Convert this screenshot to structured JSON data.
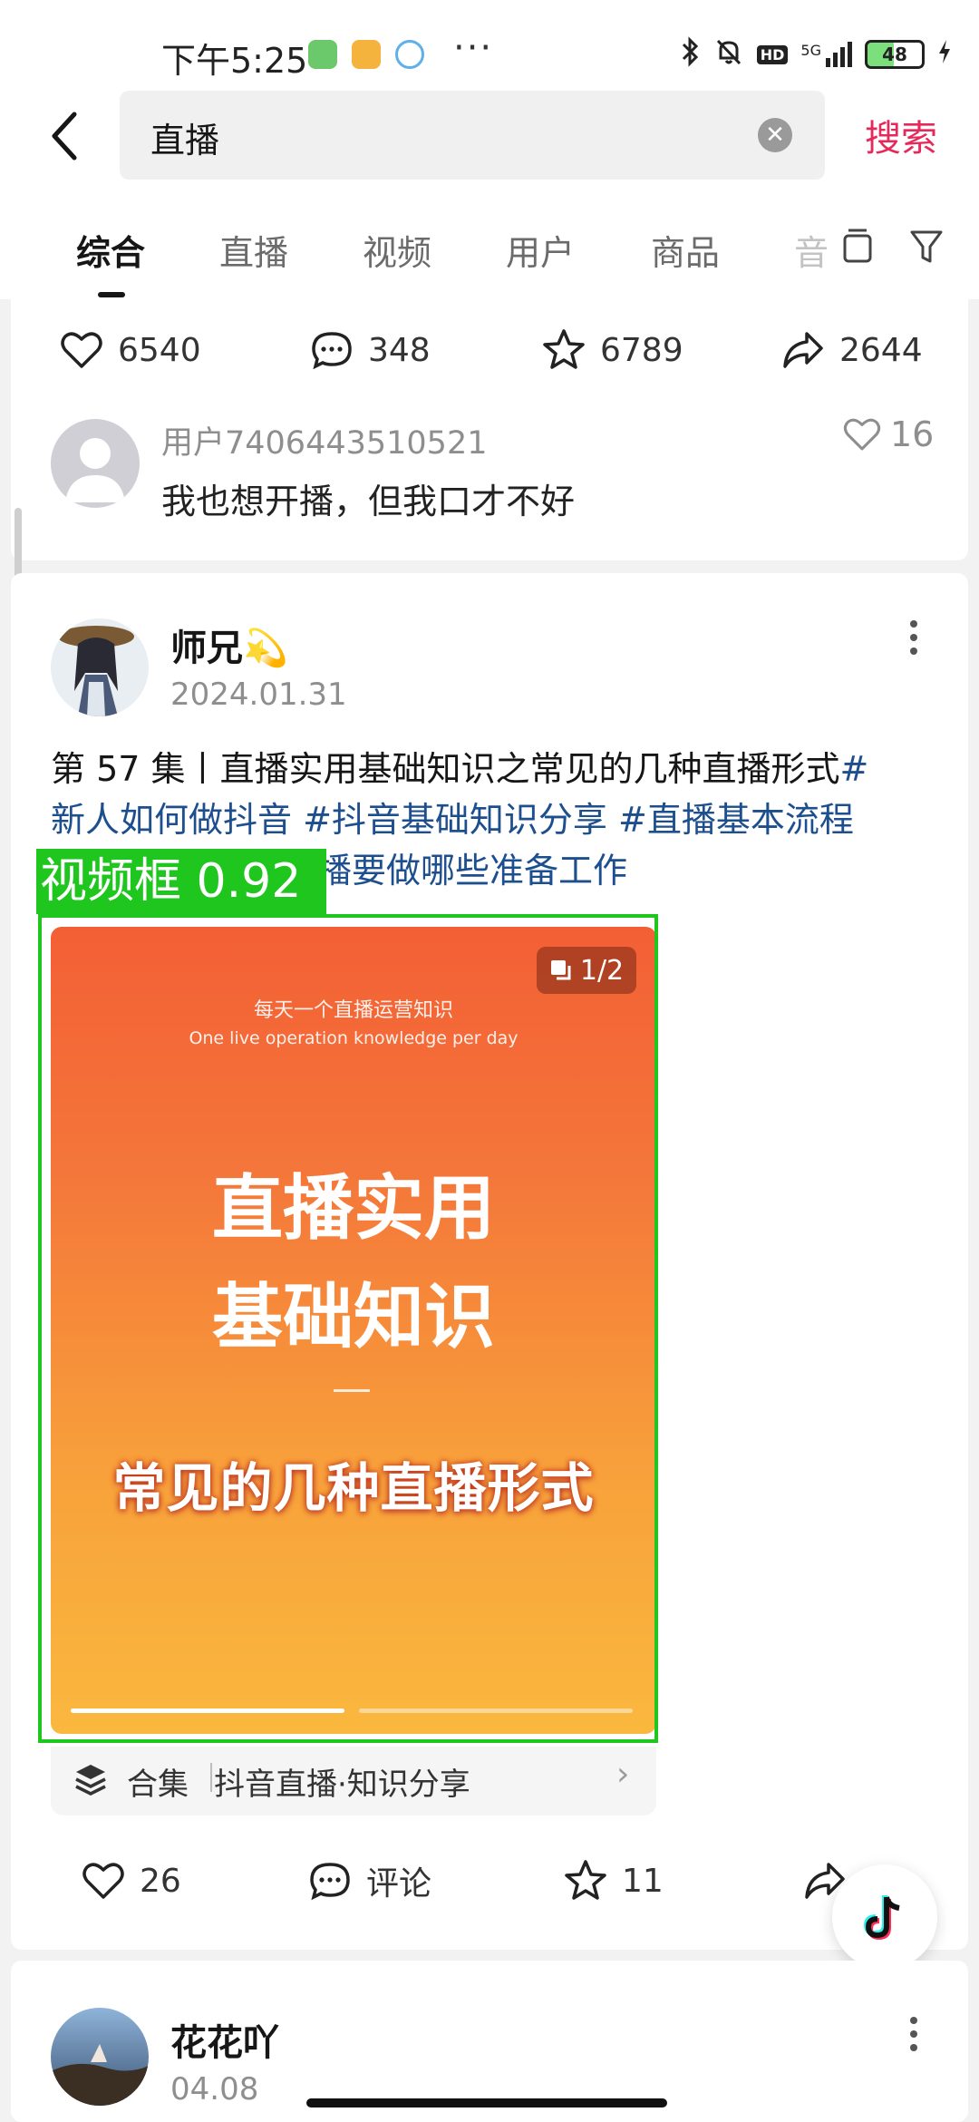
{
  "status_bar": {
    "time": "下午5:25",
    "network": "5G",
    "hd": "HD",
    "battery": "48",
    "more": "···"
  },
  "search": {
    "query": "直播",
    "button": "搜索"
  },
  "tabs": [
    "综合",
    "直播",
    "视频",
    "用户",
    "商品",
    "音"
  ],
  "active_tab": "综合",
  "prev_post": {
    "likes": "6540",
    "comments": "348",
    "favorites": "6789",
    "shares": "2644",
    "top_comment": {
      "user": "用户7406443510521",
      "text": "我也想开播，但我口才不好",
      "likes": "16"
    }
  },
  "post": {
    "author": "师兄💫",
    "date": "2024.01.31",
    "text_plain": "第 57 集丨直播实用基础知识之常见的几种直播形式",
    "tag1": "#",
    "tag1b": "新人如何做抖音",
    "tag2": " #抖音基础知识分享",
    "tag3": " #直播基本流程",
    "tag4": "直播要做哪些准备工作",
    "detection_label": "视频框 0.92",
    "video": {
      "counter": "1/2",
      "sub_cn": "每天一个直播运营知识",
      "sub_en": "One live operation knowledge per day",
      "title_line1": "直播实用",
      "title_line2": "基础知识",
      "subtitle": "常见的几种直播形式",
      "progress": 0.5
    },
    "collection": {
      "label": "合集",
      "name": "抖音直播·知识分享",
      "arrow": "›"
    },
    "likes": "26",
    "comment_label": "评论",
    "favorites": "11"
  },
  "next_post": {
    "author": "花花吖",
    "date": "04.08"
  }
}
